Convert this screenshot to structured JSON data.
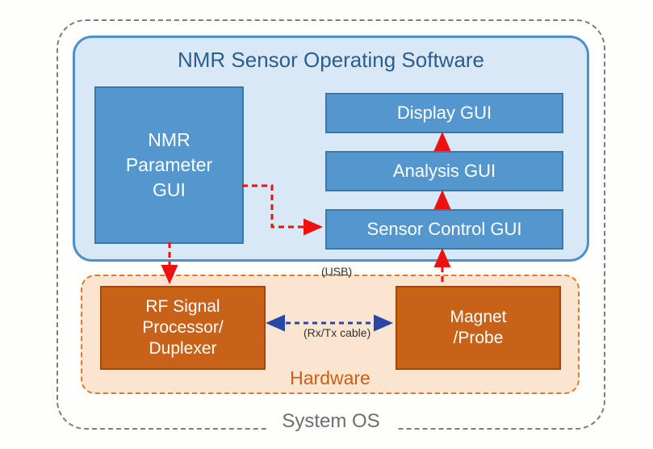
{
  "system_os_label": "System OS",
  "software": {
    "title": "NMR Sensor Operating Software",
    "nmr_param": "NMR\nParameter\nGUI",
    "display_gui": "Display GUI",
    "analysis_gui": "Analysis GUI",
    "sensor_control_gui": "Sensor Control GUI"
  },
  "hardware": {
    "label": "Hardware",
    "rf": "RF Signal\nProcessor/\nDuplexer",
    "magnet": "Magnet\n/Probe"
  },
  "connections": {
    "usb": "(USB)",
    "rxtx": "(Rx/Tx cable)"
  },
  "arrows": [
    {
      "name": "nmr-param-to-sensor-control",
      "type": "red-dashed"
    },
    {
      "name": "sensor-control-to-analysis",
      "type": "red-solid"
    },
    {
      "name": "analysis-to-display",
      "type": "red-solid"
    },
    {
      "name": "nmr-param-to-rf",
      "type": "red-dashed"
    },
    {
      "name": "rf-to-sensor-control-usb",
      "type": "red-dashed"
    },
    {
      "name": "rf-to-magnet-bidir",
      "type": "blue-dashed"
    }
  ]
}
